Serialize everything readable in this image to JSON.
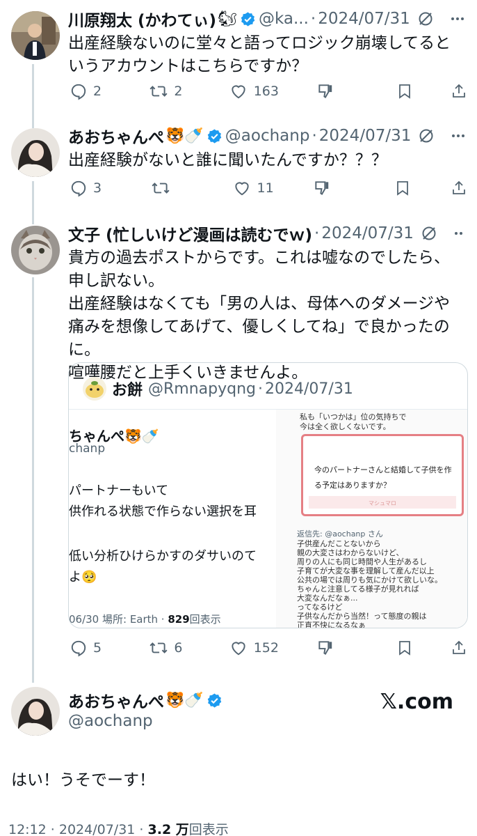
{
  "tweets": [
    {
      "name": "川原翔太 (かわてぃ)",
      "emoji": "🐿",
      "handle": "@ka...",
      "date": "2024/07/31",
      "text": "出産経験ないのに堂々と語ってロジック崩壊してるというアカウントはこちらですか？",
      "replies": "2",
      "retweets": "2",
      "likes": "163"
    },
    {
      "name": "あおちゃんぺ",
      "emoji": "🐯🍼",
      "handle": "@aochanp",
      "date": "2024/07/31",
      "text": "出産経験がないと誰に聞いたんですか？？？",
      "replies": "3",
      "retweets": "",
      "likes": "11"
    },
    {
      "name": "文子 (忙しいけど漫画は読むでｗ)",
      "emoji": "",
      "handle": "",
      "date": "2024/07/31",
      "text": "貴方の過去ポストからです。これは嘘なのでしたら、申し訳ない。\n出産経験はなくても「男の人は、母体へのダメージや痛みを想像してあげて、優しくしてね」で良かったのに。\n喧嘩腰だと上手くいきませんよ。",
      "replies": "5",
      "retweets": "6",
      "likes": "152",
      "quote": {
        "name": "お餅",
        "handle": "@Rmnapyqng",
        "date": "2024/07/31",
        "image": {
          "left_name": "ちゃんぺ🐯🍼",
          "left_handle": "chanp",
          "left_lines": [
            "パートナーもいて",
            "供作れる状態で作らない選択を耳",
            "低い分析ひけらかすのダサいのて",
            "よ🥺"
          ],
          "left_meta_prefix": "06/30 場所: Earth · ",
          "left_meta_views": "829",
          "left_meta_suffix": "回表示",
          "right_top_lines": [
            "私も「いつかは」位の気持ちで",
            "今は全く欲しくないです。"
          ],
          "marshmallow_question": "今のパートナーさんと結婚して子供を作る予定はありますか？",
          "marshmallow_label": "マシュマロ",
          "reply_to": "返信先: @aochanp さん",
          "right_lines": [
            "子供産んだことないから",
            "親の大変さはわからないけど、",
            "周りの人にも同じ時間や人生があるし",
            "子育てが大変な事を理解して産んだ以上",
            "公共の場では周りも気にかけて欲しいな。",
            "ちゃんと注意してる様子が見れれば",
            "大変なんだなぁ...",
            "ってなるけど",
            "子供なんだから当然！って態度の親は",
            "正直不快になるなぁ"
          ]
        }
      }
    }
  ],
  "main_tweet": {
    "name": "あおちゃんぺ",
    "emoji": "🐯🍼",
    "handle": "@aochanp",
    "watermark": "𝕏.com",
    "text": "はい！うそでーす！",
    "time": "12:12 · 2024/07/31 · ",
    "views": "3.2 万",
    "views_suffix": "回表示"
  },
  "colors": {
    "verified": "#1d9bf0",
    "muted": "#536471",
    "thread_line": "#cfd9de",
    "marshmallow_border": "#e57f84"
  },
  "icons": [
    "verified-badge-icon",
    "grok-icon",
    "more-icon",
    "reply-icon",
    "retweet-icon",
    "like-icon",
    "dislike-icon",
    "bookmark-icon",
    "share-icon"
  ]
}
